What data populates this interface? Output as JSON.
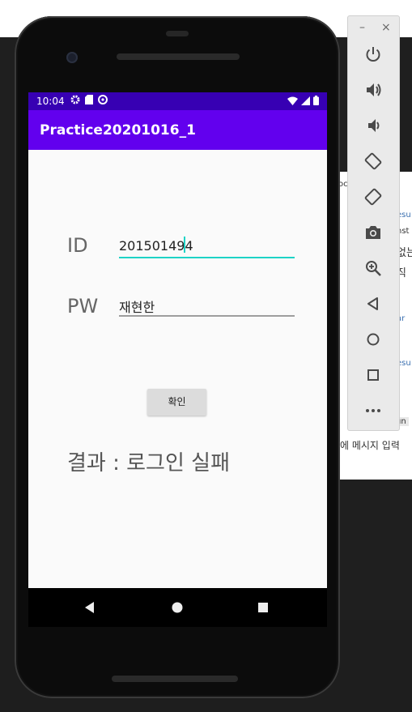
{
  "app": {
    "title": "Practice20201016_1",
    "colors": {
      "status_bar": "#3700b3",
      "app_bar": "#6200ee",
      "focus_accent": "#1ed3c6"
    }
  },
  "status_bar": {
    "time": "10:04",
    "icons_left": [
      "settings-icon",
      "sd-card-icon",
      "sync-icon"
    ],
    "icons_right": [
      "wifi-icon",
      "signal-icon",
      "battery-icon"
    ]
  },
  "form": {
    "id_label": "ID",
    "id_value": "201501494",
    "pw_label": "PW",
    "pw_value": "재현한",
    "confirm_label": "확인",
    "result_text": "결과 : 로그인 실패"
  },
  "navigation": [
    "back-icon",
    "home-icon",
    "overview-icon"
  ],
  "emulator_toolbar": {
    "window_controls": [
      "–",
      "×"
    ],
    "buttons": [
      "power-icon",
      "volume-up-icon",
      "volume-down-icon",
      "rotate-left-icon",
      "rotate-right-icon",
      "camera-icon",
      "zoom-icon",
      "back-icon",
      "home-icon",
      "overview-icon",
      "more-icon"
    ]
  },
  "background_window": {
    "lines": [
      "oc",
      "esu",
      "nst",
      "없는",
      "직 ",
      "ar",
      "esu"
    ],
    "run_label": "un",
    "input_placeholder": "에 메시지 입력"
  }
}
